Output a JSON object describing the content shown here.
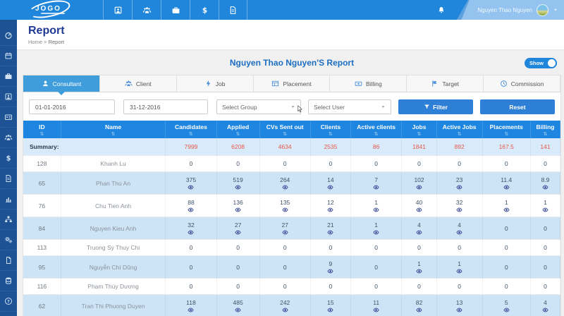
{
  "colors": {
    "topbar_blue": "#1f86db",
    "sidebar_blue": "#1d5294",
    "button_blue": "#2e7fd6",
    "tab_active_blue": "#3f9ddb",
    "table_header_blue": "#1e86e0",
    "row_highlight_blue": "#cde4f7",
    "summary_value_red": "#e8584a"
  },
  "navbar": {
    "logo_text": "JOGO",
    "menu": [
      {
        "icon": "vault-icon"
      },
      {
        "icon": "team-icon"
      },
      {
        "icon": "briefcase-icon"
      },
      {
        "icon": "dollar-icon"
      },
      {
        "icon": "report-icon"
      }
    ],
    "user_name": "Nguyen Thao Nguyen"
  },
  "sidebar": {
    "items": [
      {
        "icon": "dashboard-icon"
      },
      {
        "icon": "calendar-icon"
      },
      {
        "icon": "briefcase-icon"
      },
      {
        "icon": "vault-icon"
      },
      {
        "icon": "id-card-icon"
      },
      {
        "icon": "team-icon"
      },
      {
        "icon": "dollar-icon"
      },
      {
        "icon": "report-icon"
      },
      {
        "icon": "chart-icon"
      },
      {
        "icon": "sitemap-icon"
      },
      {
        "icon": "settings-icon"
      },
      {
        "icon": "file-icon"
      },
      {
        "icon": "database-icon"
      },
      {
        "icon": "help-icon"
      }
    ]
  },
  "page": {
    "title": "Report",
    "breadcrumb": {
      "home": "Home",
      "separator": ">",
      "current": "Report"
    }
  },
  "report": {
    "title": "Nguyen Thao Nguyen'S Report",
    "show_toggle": {
      "label": "Show",
      "state": "on"
    },
    "tabs": [
      {
        "label": "Consultant",
        "icon": "consultant-icon",
        "active": true
      },
      {
        "label": "Client",
        "icon": "client-icon",
        "active": false
      },
      {
        "label": "Job",
        "icon": "job-icon",
        "active": false
      },
      {
        "label": "Placement",
        "icon": "placement-icon",
        "active": false
      },
      {
        "label": "Billing",
        "icon": "billing-icon",
        "active": false
      },
      {
        "label": "Target",
        "icon": "target-icon",
        "active": false
      },
      {
        "label": "Commission",
        "icon": "commission-icon",
        "active": false
      }
    ],
    "filters": {
      "date_from": "01-01-2016",
      "date_to": "31-12-2016",
      "group_select": "Select Group",
      "user_select": "Select User",
      "filter_button": "Filter",
      "reset_button": "Reset"
    }
  },
  "table": {
    "columns": [
      "ID",
      "Name",
      "Candidates",
      "Applied",
      "CVs Sent out",
      "Clients",
      "Active clients",
      "Jobs",
      "Active Jobs",
      "Placements",
      "Billing"
    ],
    "summary_label": "Summary:",
    "summary_values": [
      "7999",
      "6208",
      "4634",
      "2535",
      "86",
      "1841",
      "892",
      "167.5",
      "141"
    ],
    "rows": [
      {
        "id": "128",
        "name": "Khanh Lu",
        "values": [
          "0",
          "0",
          "0",
          "0",
          "0",
          "0",
          "0",
          "0",
          "0"
        ]
      },
      {
        "id": "65",
        "name": "Phan Thu An",
        "values": [
          "375",
          "519",
          "264",
          "14",
          "7",
          "102",
          "23",
          "11.4",
          "8.9"
        ]
      },
      {
        "id": "76",
        "name": "Chu Tien Anh",
        "values": [
          "88",
          "136",
          "135",
          "12",
          "1",
          "40",
          "32",
          "1",
          "1"
        ]
      },
      {
        "id": "84",
        "name": "Nguyen Kieu Anh",
        "values": [
          "32",
          "27",
          "27",
          "21",
          "1",
          "4",
          "4",
          "0",
          "0"
        ]
      },
      {
        "id": "113",
        "name": "Truong Sy Thuy Chi",
        "values": [
          "0",
          "0",
          "0",
          "0",
          "0",
          "0",
          "0",
          "0",
          "0"
        ]
      },
      {
        "id": "95",
        "name": "Nguyễn Chí Dũng",
        "values": [
          "0",
          "0",
          "0",
          "9",
          "0",
          "1",
          "1",
          "0",
          "0"
        ]
      },
      {
        "id": "116",
        "name": "Phạm Thúy Dương",
        "values": [
          "0",
          "0",
          "0",
          "0",
          "0",
          "0",
          "0",
          "0",
          "0"
        ]
      },
      {
        "id": "62",
        "name": "Tran Thi Phuong Duyen",
        "values": [
          "118",
          "485",
          "242",
          "15",
          "11",
          "82",
          "13",
          "5",
          "4"
        ]
      }
    ]
  }
}
